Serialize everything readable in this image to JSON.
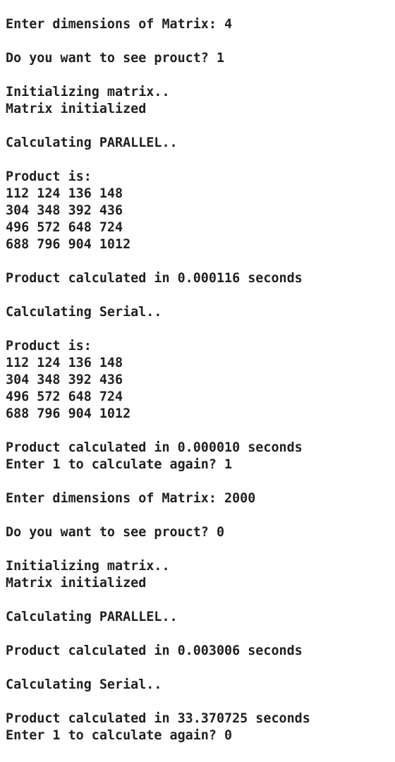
{
  "console": {
    "lines": [
      "Enter dimensions of Matrix: 4",
      "",
      "Do you want to see prouct? 1",
      "",
      "Initializing matrix..",
      "Matrix initialized",
      "",
      "Calculating PARALLEL..",
      "",
      "Product is:",
      "112 124 136 148",
      "304 348 392 436",
      "496 572 648 724",
      "688 796 904 1012",
      "",
      "Product calculated in 0.000116 seconds",
      "",
      "Calculating Serial..",
      "",
      "Product is:",
      "112 124 136 148",
      "304 348 392 436",
      "496 572 648 724",
      "688 796 904 1012",
      "",
      "Product calculated in 0.000010 seconds",
      "Enter 1 to calculate again? 1",
      "",
      "Enter dimensions of Matrix: 2000",
      "",
      "Do you want to see prouct? 0",
      "",
      "Initializing matrix..",
      "Matrix initialized",
      "",
      "Calculating PARALLEL..",
      "",
      "Product calculated in 0.003006 seconds",
      "",
      "Calculating Serial..",
      "",
      "Product calculated in 33.370725 seconds",
      "Enter 1 to calculate again? 0"
    ]
  }
}
